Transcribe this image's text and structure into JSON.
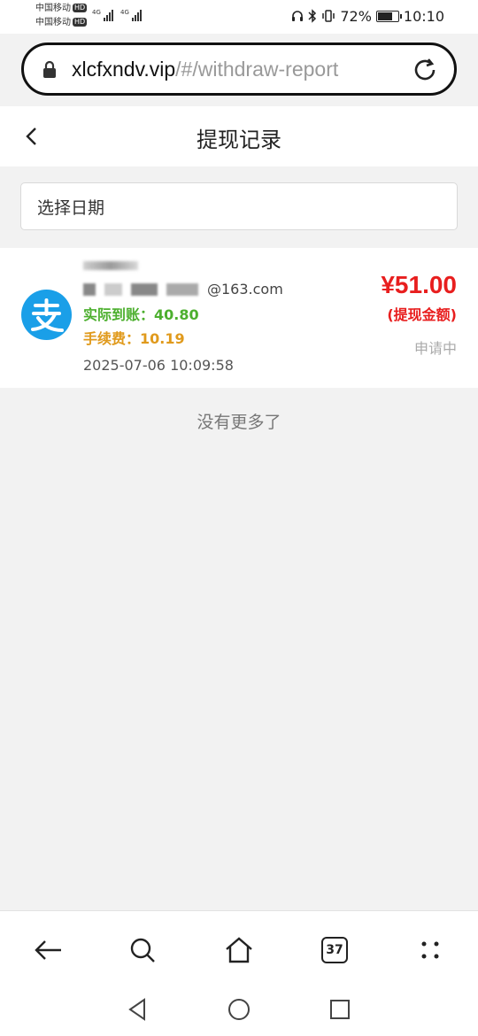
{
  "status_bar": {
    "carrier1": "中国移动",
    "carrier2": "中国移动",
    "hd": "HD",
    "net1": "4G",
    "net2": "4G",
    "battery_percent": "72%",
    "battery_level": 0.72,
    "time": "10:10"
  },
  "browser": {
    "url_host": "xlcfxndv.vip",
    "url_path": "/#/withdraw-report",
    "tab_count": "37"
  },
  "header": {
    "title": "提现记录"
  },
  "filter": {
    "date_placeholder": "选择日期"
  },
  "record": {
    "account_suffix": "@163.com",
    "received_label": "实际到账：",
    "received_value": "40.80",
    "fee_label": "手续费：",
    "fee_value": "10.19",
    "time": "2025-07-06 10:09:58",
    "amount": "¥51.00",
    "amount_label": "(提现金额)",
    "status": "申请中"
  },
  "list": {
    "no_more": "没有更多了"
  },
  "colors": {
    "alipay_blue": "#1a9fe8",
    "amount_red": "#e81e1e",
    "received_green": "#4caf2e",
    "fee_orange": "#e09a1c"
  }
}
